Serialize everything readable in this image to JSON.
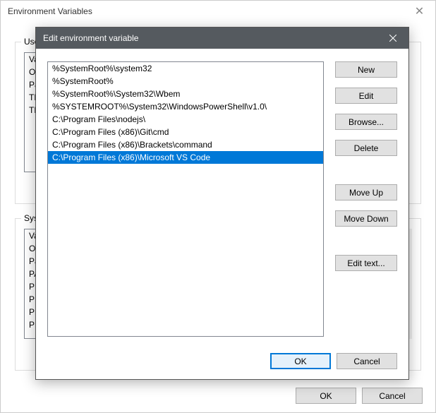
{
  "parentDialog": {
    "title": "Environment Variables",
    "userGroup": {
      "legend": "User",
      "rows": [
        "Va",
        "O",
        "Pa",
        "TE",
        "TM"
      ]
    },
    "systemGroup": {
      "legend": "Syste",
      "rows": [
        "Va",
        "OS",
        "Pa",
        "PA",
        "PR",
        "PR",
        "PR",
        "PR"
      ]
    },
    "okLabel": "OK",
    "cancelLabel": "Cancel"
  },
  "childDialog": {
    "title": "Edit environment variable",
    "items": [
      "%SystemRoot%\\system32",
      "%SystemRoot%",
      "%SystemRoot%\\System32\\Wbem",
      "%SYSTEMROOT%\\System32\\WindowsPowerShell\\v1.0\\",
      "C:\\Program Files\\nodejs\\",
      "C:\\Program Files (x86)\\Git\\cmd",
      "C:\\Program Files (x86)\\Brackets\\command",
      "C:\\Program Files (x86)\\Microsoft VS Code"
    ],
    "selectedIndex": 7,
    "buttons": {
      "new": "New",
      "edit": "Edit",
      "browse": "Browse...",
      "delete": "Delete",
      "moveUp": "Move Up",
      "moveDown": "Move Down",
      "editText": "Edit text...",
      "ok": "OK",
      "cancel": "Cancel"
    }
  }
}
